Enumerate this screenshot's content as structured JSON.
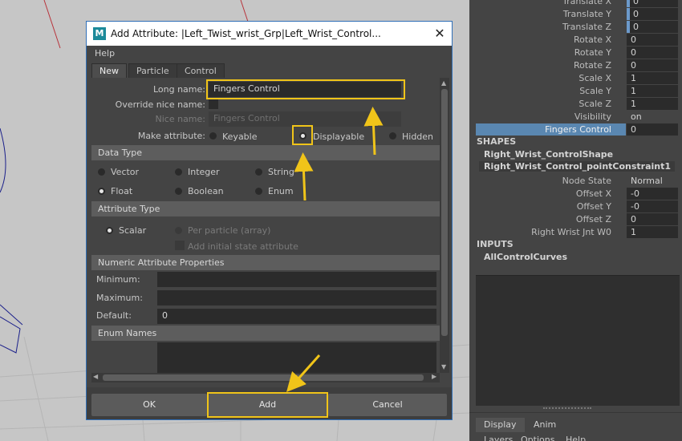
{
  "dialog": {
    "title": "Add Attribute: |Left_Twist_wrist_Grp|Left_Wrist_Control...",
    "logo_letter": "M",
    "menu_help": "Help",
    "tabs": [
      "New",
      "Particle",
      "Control"
    ],
    "long_name_label": "Long name:",
    "long_name_value": "Fingers Control",
    "override_label": "Override nice name:",
    "nice_name_label": "Nice name:",
    "nice_name_value": "Fingers  Control",
    "make_attr_label": "Make attribute:",
    "make_options": [
      "Keyable",
      "Displayable",
      "Hidden"
    ],
    "make_selected": "Displayable",
    "data_type_header": "Data Type",
    "data_types": [
      "Vector",
      "Integer",
      "String",
      "Float",
      "Boolean",
      "Enum"
    ],
    "data_type_selected": "Float",
    "attr_type_header": "Attribute Type",
    "scalar_label": "Scalar",
    "per_particle_label": "Per particle (array)",
    "initial_state_label": "Add initial state attribute",
    "numeric_header": "Numeric Attribute Properties",
    "minimum_label": "Minimum:",
    "maximum_label": "Maximum:",
    "default_label": "Default:",
    "default_value": "0",
    "enum_header": "Enum Names",
    "buttons": {
      "ok": "OK",
      "add": "Add",
      "cancel": "Cancel"
    },
    "close_icon": "close-icon",
    "highlight_color": "#f0c419"
  },
  "channel_box": {
    "top_rows": [
      {
        "label": "Translate X",
        "value": "0"
      },
      {
        "label": "Translate Y",
        "value": "0"
      },
      {
        "label": "Translate Z",
        "value": "0"
      },
      {
        "label": "Rotate X",
        "value": "0"
      },
      {
        "label": "Rotate Y",
        "value": "0"
      },
      {
        "label": "Rotate Z",
        "value": "0"
      },
      {
        "label": "Scale X",
        "value": "1"
      },
      {
        "label": "Scale Y",
        "value": "1"
      },
      {
        "label": "Scale Z",
        "value": "1"
      },
      {
        "label": "Visibility",
        "value": "on"
      },
      {
        "label": "Fingers Control",
        "value": "0"
      }
    ],
    "shapes_header": "SHAPES",
    "shape_nodes": [
      "Right_Wrist_ControlShape",
      "Right_Wrist_Control_pointConstraint1"
    ],
    "constraint_rows": [
      {
        "label": "Node State",
        "value": "Normal"
      },
      {
        "label": "Offset X",
        "value": "-0"
      },
      {
        "label": "Offset Y",
        "value": "-0"
      },
      {
        "label": "Offset Z",
        "value": "0"
      },
      {
        "label": "Right Wrist Jnt W0",
        "value": "1"
      }
    ],
    "inputs_header": "INPUTS",
    "input_nodes": [
      "AllControlCurves"
    ],
    "bottom_tabs": [
      "Display",
      "Anim"
    ],
    "bottom_menus": [
      "Layers",
      "Options",
      "Help"
    ],
    "selected_color": "#5a87b1"
  }
}
